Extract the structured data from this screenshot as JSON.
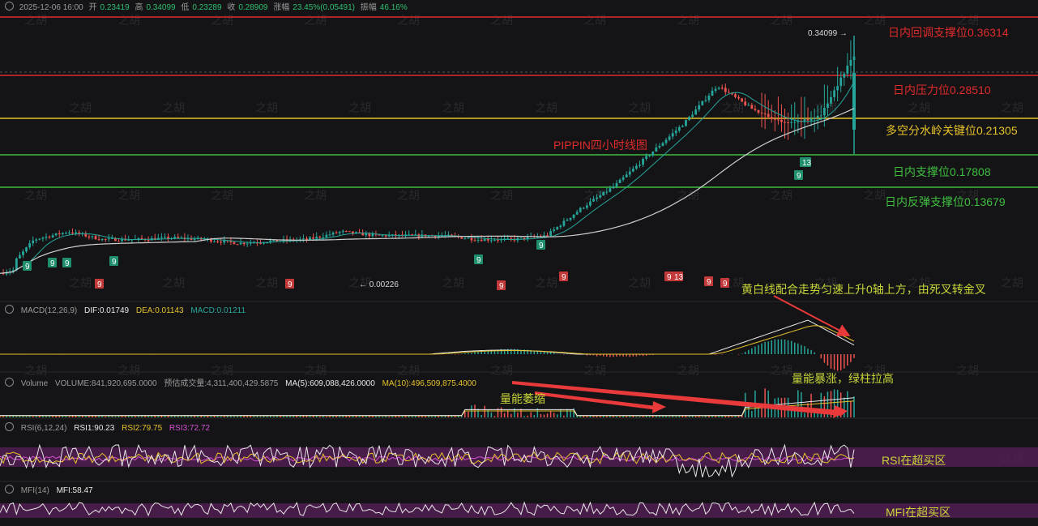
{
  "ohlc_bar": {
    "datetime": "2025-12-06 16:00",
    "open_label": "开",
    "open": "0.23419",
    "high_label": "高",
    "high": "0.34099",
    "low_label": "低",
    "low": "0.23289",
    "close_label": "收",
    "close": "0.28909",
    "change_label": "涨幅",
    "change": "23.45%(0.05491)",
    "amplitude_label": "振幅",
    "amplitude": "46.16%"
  },
  "macd_header": {
    "name": "MACD(12,26,9)",
    "dif": "DIF:0.01749",
    "dea": "DEA:0.01143",
    "macd": "MACD:0.01211"
  },
  "volume_header": {
    "name": "Volume",
    "volume": "VOLUME:841,920,695.0000",
    "estimate": "预估成交量:4,311,400,429.5875",
    "ma5": "MA(5):609,088,426.0000",
    "ma10": "MA(10):496,509,875.4000"
  },
  "rsi_header": {
    "name": "RSI(6,12,24)",
    "rsi1": "RSI1:90.23",
    "rsi2": "RSI2:79.75",
    "rsi3": "RSI3:72.72"
  },
  "mfi_header": {
    "name": "MFI(14)",
    "mfi": "MFI:58.47"
  },
  "price_levels": [
    {
      "label": "日内回调支撑位0.36314",
      "value": 0.36314,
      "color": "#e02b2b"
    },
    {
      "label": "日内压力位0.28510",
      "value": 0.2851,
      "color": "#e02b2b"
    },
    {
      "label": "多空分水岭关键位0.21305",
      "value": 0.21305,
      "color": "#e6c229"
    },
    {
      "label": "日内支撑位0.17808",
      "value": 0.17808,
      "color": "#3fbf3f"
    },
    {
      "label": "日内反弹支撑位0.13679",
      "value": 0.13679,
      "color": "#3fbf3f"
    }
  ],
  "annotations": {
    "chart_title": "PIPPIN四小时线图",
    "macd_note": "黄白线配合走势匀速上升0轴上方，由死叉转金叉",
    "volume_spike_note": "量能暴涨，绿柱拉高",
    "volume_shrink_note": "量能萎缩",
    "rsi_note": "RSI在超买区",
    "mfi_note": "MFI在超买区"
  },
  "price_tags": {
    "high": "0.34099",
    "low": "0.00226"
  },
  "watermark": "之胡",
  "colors": {
    "up": "#26a69a",
    "down": "#ef5350",
    "dif": "#e8e8e8",
    "dea": "#e6c229",
    "ma5": "#e8e8e8",
    "ma10": "#e6c229",
    "rsi1": "#e8e8e8",
    "rsi2": "#e6c229",
    "rsi3": "#d64fd6",
    "ma_fast": "#26a69a",
    "ma_slow": "#cfcfcf",
    "overbought": "#5a1f5a"
  },
  "chart_data": {
    "type": "line",
    "title": "PIPPIN四小时线图",
    "y_price": [
      0.0,
      0.05,
      0.06,
      0.05,
      0.05,
      0.052,
      0.05,
      0.045,
      0.048,
      0.05,
      0.06,
      0.055,
      0.055,
      0.055,
      0.05,
      0.05,
      0.055,
      0.09,
      0.12,
      0.16,
      0.2,
      0.25,
      0.22,
      0.2,
      0.21,
      0.28909
    ],
    "sequential_marks": {
      "green_9": 8,
      "green_13": 1,
      "red_9": 7,
      "red_13": 1
    },
    "indicators": {
      "macd": {
        "dif": 0.01749,
        "dea": 0.01143,
        "macd": 0.01211
      },
      "volume": {
        "volume": 841920695.0,
        "ma5": 609088426.0,
        "ma10": 496509875.4
      },
      "rsi": {
        "rsi1": 90.23,
        "rsi2": 79.75,
        "rsi3": 72.72
      },
      "mfi": 58.47
    }
  }
}
